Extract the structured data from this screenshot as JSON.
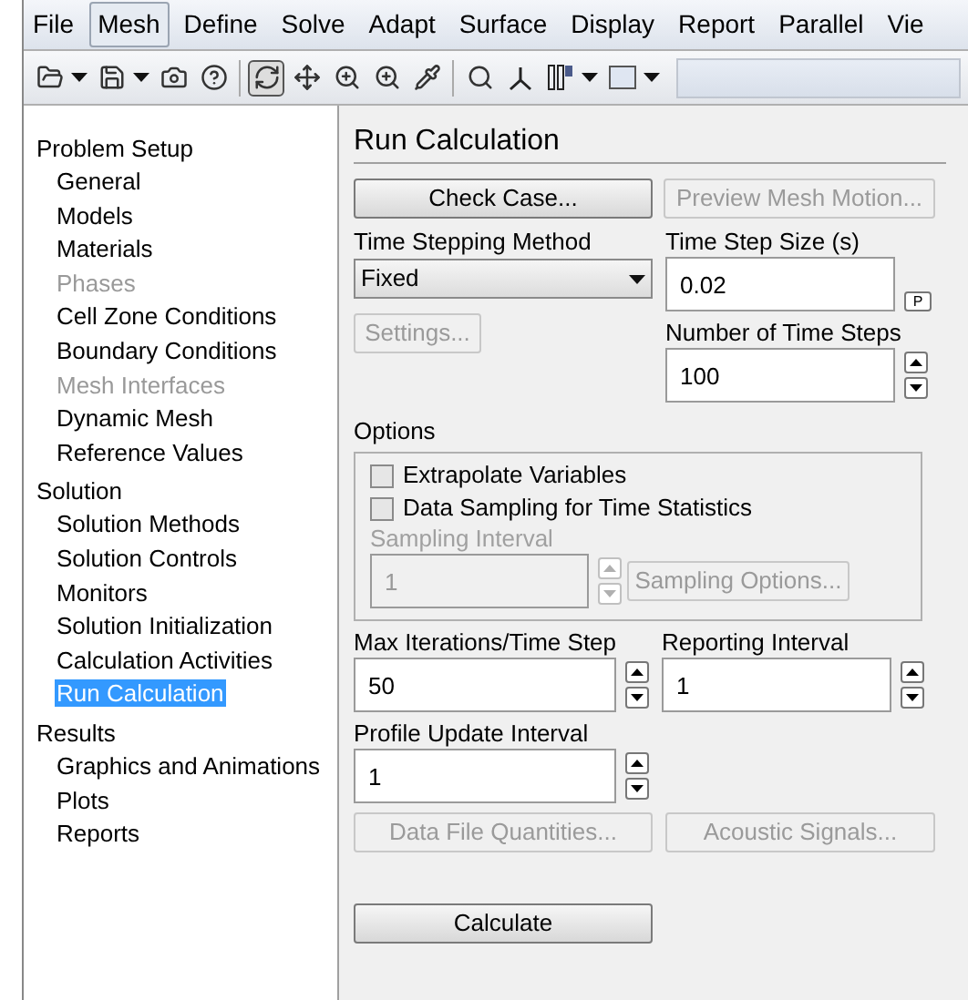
{
  "menu": [
    {
      "label": "File",
      "selected": false
    },
    {
      "label": "Mesh",
      "selected": true
    },
    {
      "label": "Define",
      "selected": false
    },
    {
      "label": "Solve",
      "selected": false
    },
    {
      "label": "Adapt",
      "selected": false
    },
    {
      "label": "Surface",
      "selected": false
    },
    {
      "label": "Display",
      "selected": false
    },
    {
      "label": "Report",
      "selected": false
    },
    {
      "label": "Parallel",
      "selected": false
    },
    {
      "label": "Vie",
      "selected": false
    }
  ],
  "tree": [
    {
      "label": "Problem Setup",
      "children": [
        {
          "label": "General",
          "disabled": false,
          "selected": false
        },
        {
          "label": "Models",
          "disabled": false,
          "selected": false
        },
        {
          "label": "Materials",
          "disabled": false,
          "selected": false
        },
        {
          "label": "Phases",
          "disabled": true,
          "selected": false
        },
        {
          "label": "Cell Zone Conditions",
          "disabled": false,
          "selected": false
        },
        {
          "label": "Boundary Conditions",
          "disabled": false,
          "selected": false
        },
        {
          "label": "Mesh Interfaces",
          "disabled": true,
          "selected": false
        },
        {
          "label": "Dynamic Mesh",
          "disabled": false,
          "selected": false
        },
        {
          "label": "Reference Values",
          "disabled": false,
          "selected": false
        }
      ]
    },
    {
      "label": "Solution",
      "children": [
        {
          "label": "Solution Methods",
          "disabled": false,
          "selected": false
        },
        {
          "label": "Solution Controls",
          "disabled": false,
          "selected": false
        },
        {
          "label": "Monitors",
          "disabled": false,
          "selected": false
        },
        {
          "label": "Solution Initialization",
          "disabled": false,
          "selected": false
        },
        {
          "label": "Calculation Activities",
          "disabled": false,
          "selected": false
        },
        {
          "label": "Run Calculation",
          "disabled": false,
          "selected": true
        }
      ]
    },
    {
      "label": "Results",
      "children": [
        {
          "label": "Graphics and Animations",
          "disabled": false,
          "selected": false
        },
        {
          "label": "Plots",
          "disabled": false,
          "selected": false
        },
        {
          "label": "Reports",
          "disabled": false,
          "selected": false
        }
      ]
    }
  ],
  "panel": {
    "title": "Run Calculation",
    "check_case": {
      "label": "Check Case...",
      "disabled": false
    },
    "preview_mesh_motion": {
      "label": "Preview Mesh Motion...",
      "disabled": true
    },
    "time_stepping_method": {
      "label": "Time Stepping Method",
      "value": "Fixed"
    },
    "settings": {
      "label": "Settings...",
      "disabled": true
    },
    "time_step_size": {
      "label": "Time Step Size (s)",
      "value": "0.02",
      "param": "P"
    },
    "number_of_time_steps": {
      "label": "Number of Time Steps",
      "value": "100"
    },
    "options": {
      "label": "Options",
      "checkboxes": [
        {
          "label": "Extrapolate Variables",
          "checked": false
        },
        {
          "label": "Data Sampling for Time Statistics",
          "checked": false
        }
      ],
      "sampling_interval": {
        "label": "Sampling Interval",
        "value": "1",
        "disabled": true
      },
      "sampling_options": {
        "label": "Sampling Options...",
        "disabled": true
      }
    },
    "max_iterations": {
      "label": "Max Iterations/Time Step",
      "value": "50"
    },
    "reporting_interval": {
      "label": "Reporting Interval",
      "value": "1"
    },
    "profile_update_interval": {
      "label": "Profile Update Interval",
      "value": "1"
    },
    "data_file_quantities": {
      "label": "Data File Quantities...",
      "disabled": true
    },
    "acoustic_signals": {
      "label": "Acoustic Signals...",
      "disabled": true
    },
    "calculate": {
      "label": "Calculate",
      "disabled": false
    }
  }
}
